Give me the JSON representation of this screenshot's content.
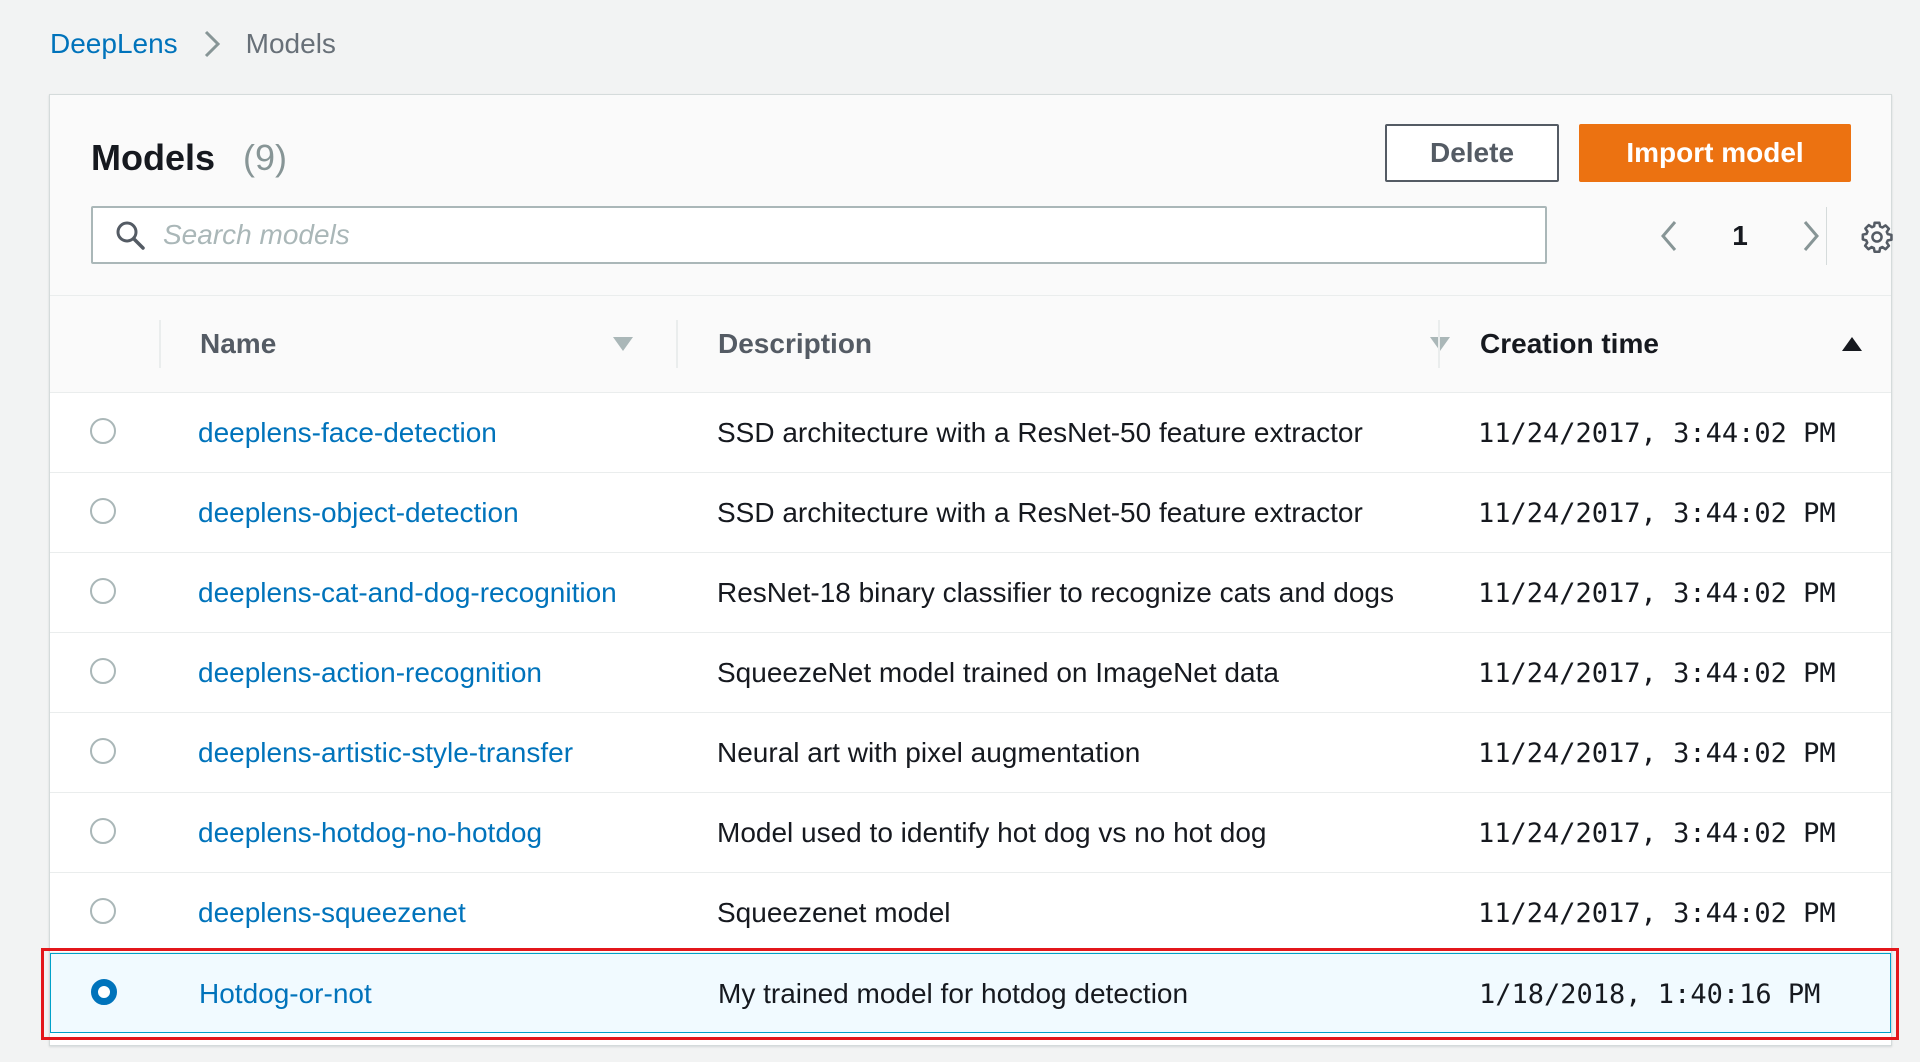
{
  "breadcrumb": {
    "parent": "DeepLens",
    "current": "Models"
  },
  "header": {
    "title": "Models",
    "count": "(9)",
    "delete_label": "Delete",
    "import_label": "Import model"
  },
  "search": {
    "placeholder": "Search models"
  },
  "pagination": {
    "current_page": "1"
  },
  "table": {
    "columns": {
      "name": "Name",
      "description": "Description",
      "creation_time": "Creation time"
    },
    "sorted_by": "Creation time",
    "rows": [
      {
        "name": "deeplens-face-detection",
        "description": "SSD architecture with a ResNet-50 feature extractor",
        "time": "11/24/2017, 3:44:02 PM",
        "selected": false
      },
      {
        "name": "deeplens-object-detection",
        "description": "SSD architecture with a ResNet-50 feature extractor",
        "time": "11/24/2017, 3:44:02 PM",
        "selected": false
      },
      {
        "name": "deeplens-cat-and-dog-recognition",
        "description": "ResNet-18 binary classifier to recognize cats and dogs",
        "time": "11/24/2017, 3:44:02 PM",
        "selected": false
      },
      {
        "name": "deeplens-action-recognition",
        "description": "SqueezeNet model trained on ImageNet data",
        "time": "11/24/2017, 3:44:02 PM",
        "selected": false
      },
      {
        "name": "deeplens-artistic-style-transfer",
        "description": "Neural art with pixel augmentation",
        "time": "11/24/2017, 3:44:02 PM",
        "selected": false
      },
      {
        "name": "deeplens-hotdog-no-hotdog",
        "description": "Model used to identify hot dog vs no hot dog",
        "time": "11/24/2017, 3:44:02 PM",
        "selected": false
      },
      {
        "name": "deeplens-squeezenet",
        "description": "Squeezenet model",
        "time": "11/24/2017, 3:44:02 PM",
        "selected": false
      },
      {
        "name": "Hotdog-or-not",
        "description": "My trained model for hotdog detection",
        "time": "1/18/2018, 1:40:16 PM",
        "selected": true
      }
    ]
  },
  "icons": {
    "breadcrumb_separator": "chevron-right-icon",
    "search": "search-icon",
    "prev": "chevron-left-icon",
    "next": "chevron-right-icon",
    "settings": "gear-icon",
    "sort_inactive": "caret-down-icon",
    "sort_active": "caret-up-icon"
  },
  "colors": {
    "link": "#0073bb",
    "primary_button": "#ec7211",
    "selected_row_bg": "#f1faff",
    "selected_row_border": "#00a1c9",
    "highlight": "#e3171b"
  }
}
